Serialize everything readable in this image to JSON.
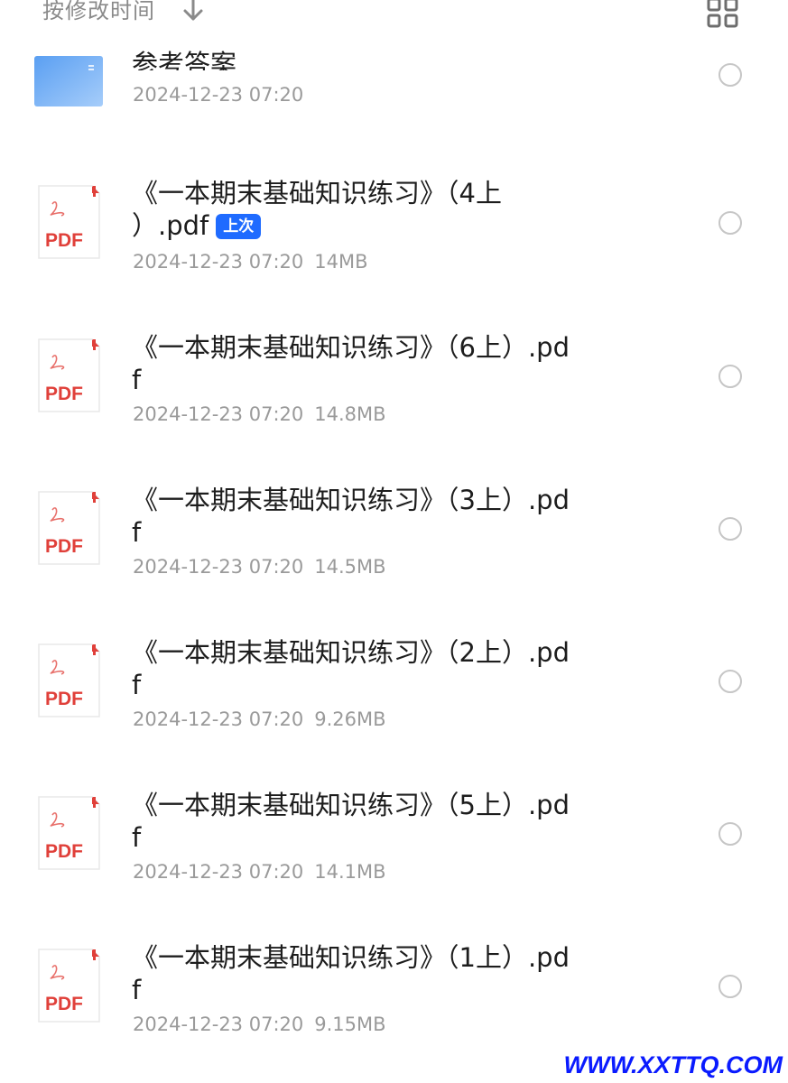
{
  "sortbar": {
    "label": "按修改时间",
    "arrow_icon": "arrow-down-icon",
    "view_icon": "grid-view-icon"
  },
  "folder": {
    "name": "参考答案",
    "date": "2024-12-23 07:20",
    "icon": "folder-icon",
    "color": "#6aaaf5"
  },
  "files": [
    {
      "name": "《一本期末基础知识练习》（4上）.pdf",
      "name_line1": "《一本期末基础知识练习》（4上",
      "name_line2": "）.pdf",
      "badge": "上次",
      "date": "2024-12-23 07:20",
      "size": "14MB"
    },
    {
      "name_line1": "《一本期末基础知识练习》（6上）.pd",
      "name_line2": "f",
      "date": "2024-12-23 07:20",
      "size": "14.8MB"
    },
    {
      "name_line1": "《一本期末基础知识练习》（3上）.pd",
      "name_line2": "f",
      "date": "2024-12-23 07:20",
      "size": "14.5MB"
    },
    {
      "name_line1": "《一本期末基础知识练习》（2上）.pd",
      "name_line2": "f",
      "date": "2024-12-23 07:20",
      "size": "9.26MB"
    },
    {
      "name_line1": "《一本期末基础知识练习》（5上）.pd",
      "name_line2": "f",
      "date": "2024-12-23 07:20",
      "size": "14.1MB"
    },
    {
      "name_line1": "《一本期末基础知识练习》（1上）.pd",
      "name_line2": "f",
      "date": "2024-12-23 07:20",
      "size": "9.15MB"
    }
  ],
  "pdf_icon": {
    "label": "PDF",
    "color": "#e0403a"
  },
  "badge_color": "#1f6bff",
  "watermark": "WWW.XXTTQ.COM"
}
